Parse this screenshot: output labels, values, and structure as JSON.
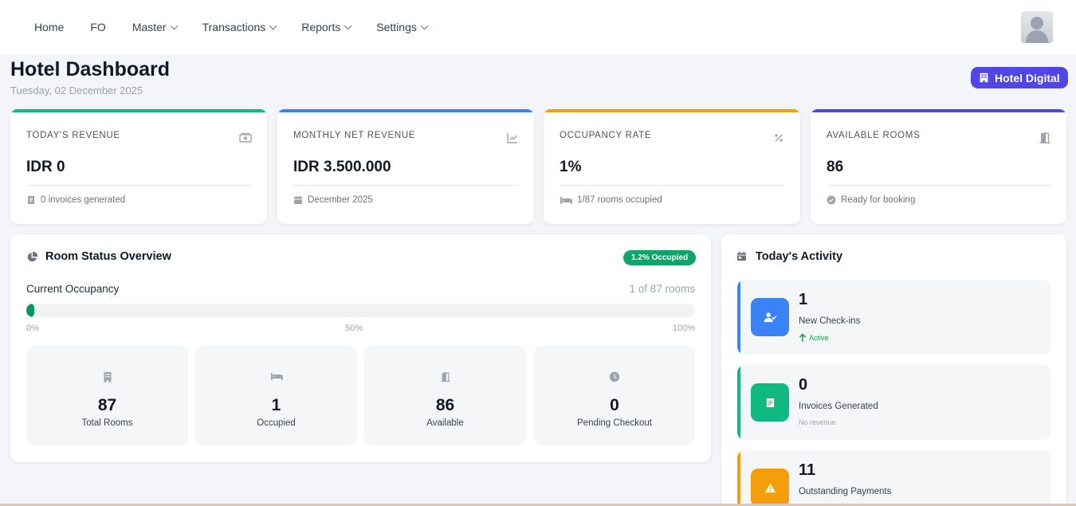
{
  "nav": {
    "items": [
      {
        "label": "Home",
        "dropdown": false
      },
      {
        "label": "FO",
        "dropdown": false
      },
      {
        "label": "Master",
        "dropdown": true
      },
      {
        "label": "Transactions",
        "dropdown": true
      },
      {
        "label": "Reports",
        "dropdown": true
      },
      {
        "label": "Settings",
        "dropdown": true
      }
    ]
  },
  "header": {
    "title": "Hotel Dashboard",
    "date": "Tuesday, 02 December 2025",
    "hotel_badge": "Hotel Digital"
  },
  "stats": [
    {
      "label": "TODAY'S REVENUE",
      "value": "IDR 0",
      "foot": "0 invoices generated",
      "icon": "money-icon",
      "foot_icon": "invoice-icon",
      "color": "#10b981"
    },
    {
      "label": "MONTHLY NET REVENUE",
      "value": "IDR 3.500.000",
      "foot": "December 2025",
      "icon": "chart-line-icon",
      "foot_icon": "calendar-icon",
      "color": "#3b82f6"
    },
    {
      "label": "OCCUPANCY RATE",
      "value": "1%",
      "foot": "1/87 rooms occupied",
      "icon": "percent-icon",
      "foot_icon": "bed-icon",
      "color": "#f59e0b"
    },
    {
      "label": "AVAILABLE ROOMS",
      "value": "86",
      "foot": "Ready for booking",
      "icon": "door-open-icon",
      "foot_icon": "check-circle-icon",
      "color": "#4f46e5"
    }
  ],
  "room_status": {
    "title": "Room Status Overview",
    "badge": "1.2% Occupied",
    "occupancy_label": "Current Occupancy",
    "occupancy_count": "1 of 87 rooms",
    "occupancy_fraction": 0.012,
    "scale": [
      "0%",
      "50%",
      "100%"
    ],
    "boxes": [
      {
        "value": "87",
        "label": "Total Rooms",
        "icon": "building-icon"
      },
      {
        "value": "1",
        "label": "Occupied",
        "icon": "bed-icon"
      },
      {
        "value": "86",
        "label": "Available",
        "icon": "door-open-icon"
      },
      {
        "value": "0",
        "label": "Pending Checkout",
        "icon": "clock-icon"
      }
    ]
  },
  "activity": {
    "title": "Today's Activity",
    "items": [
      {
        "value": "1",
        "label": "New Check-ins",
        "sub": "Active",
        "icon": "user-check-icon",
        "color": "#3b82f6"
      },
      {
        "value": "0",
        "label": "Invoices Generated",
        "sub": "No revenue",
        "icon": "invoice-icon",
        "color": "#10b981"
      },
      {
        "value": "11",
        "label": "Outstanding Payments",
        "sub": "",
        "icon": "warning-icon",
        "color": "#f59e0b"
      }
    ]
  }
}
